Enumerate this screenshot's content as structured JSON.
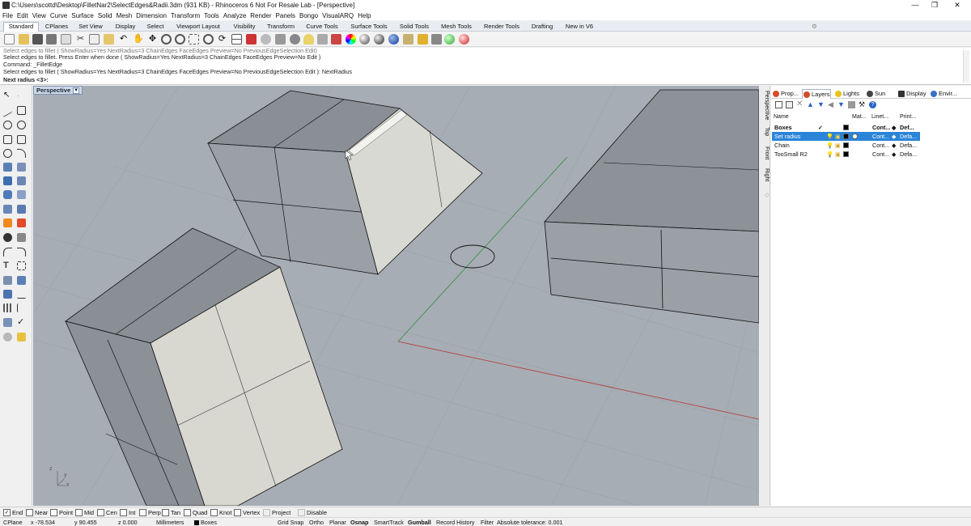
{
  "window": {
    "title": "C:\\Users\\scottd\\Desktop\\FilletNar2\\SelectEdges&Radii.3dm (931 KB) - Rhinoceros 6 Not For Resale Lab - [Perspective]",
    "min": "—",
    "max": "❐",
    "close": "✕"
  },
  "menu": [
    "File",
    "Edit",
    "View",
    "Curve",
    "Surface",
    "Solid",
    "Mesh",
    "Dimension",
    "Transform",
    "Tools",
    "Analyze",
    "Render",
    "Panels",
    "Bongo",
    "VisualARQ",
    "Help"
  ],
  "tabs": [
    "Standard",
    "CPlanes",
    "Set View",
    "Display",
    "Select",
    "Viewport Layout",
    "Visibility",
    "Transform",
    "Curve Tools",
    "Surface Tools",
    "Solid Tools",
    "Mesh Tools",
    "Render Tools",
    "Drafting",
    "New in V6"
  ],
  "command": {
    "history": [
      "Select edges to fillet ( ShowRadius=Yes  NextRadius=3  ChainEdges  FaceEdges  Preview=No  PreviousEdgeSelection  Edit)",
      "Select edges to fillet. Press Enter when done ( ShowRadius=Yes  NextRadius=3  ChainEdges  FaceEdges  Preview=No  Edit )",
      "Command: _FilletEdge",
      "Select edges to fillet ( ShowRadius=Yes  NextRadius=3  ChainEdges  FaceEdges  Preview=No  PreviousEdgeSelection  Edit ): NextRadius"
    ],
    "prompt": "Next radius <3>:"
  },
  "viewport": {
    "name": "Perspective",
    "axis_z": "z",
    "axis_y": "y",
    "axis_x": "x"
  },
  "viewport_tabs": [
    "Perspective",
    "Top",
    "Front",
    "Right"
  ],
  "panel": {
    "tabs": [
      "Prop...",
      "Layers",
      "Lights",
      "Sun",
      "Display",
      "Envir..."
    ],
    "tab_colors": [
      "#d64b2a",
      "#d04e26",
      "#e8c21a",
      "#444444",
      "#333333",
      "#3b6ec9"
    ],
    "columns": {
      "name": "Name",
      "material": "Mat...",
      "linetype": "Linet...",
      "print": "Print..."
    },
    "layers": [
      {
        "name": "Boxes",
        "current": "✓",
        "linetype": "Cont...",
        "print": "Def...",
        "bold": true,
        "selected": false
      },
      {
        "name": "Set radius",
        "current": "",
        "linetype": "Cont...",
        "print": "Defa...",
        "bold": false,
        "selected": true
      },
      {
        "name": "Chain",
        "current": "",
        "linetype": "Cont...",
        "print": "Defa...",
        "bold": false,
        "selected": false
      },
      {
        "name": "TooSmall R2",
        "current": "",
        "linetype": "Cont...",
        "print": "Defa...",
        "bold": false,
        "selected": false
      }
    ]
  },
  "osnap": [
    {
      "label": "End",
      "checked": true
    },
    {
      "label": "Near",
      "checked": false
    },
    {
      "label": "Point",
      "checked": false
    },
    {
      "label": "Mid",
      "checked": false
    },
    {
      "label": "Cen",
      "checked": false
    },
    {
      "label": "Int",
      "checked": false
    },
    {
      "label": "Perp",
      "checked": false
    },
    {
      "label": "Tan",
      "checked": false
    },
    {
      "label": "Quad",
      "checked": false
    },
    {
      "label": "Knot",
      "checked": false
    },
    {
      "label": "Vertex",
      "checked": false
    },
    {
      "label": "Project",
      "checked": false
    },
    {
      "label": "Disable",
      "checked": false
    }
  ],
  "status": {
    "cplane": "CPlane",
    "x": "x -78.534",
    "y": "y 90.455",
    "z": "z 0.000",
    "units": "Millimeters",
    "layer": "Boxes",
    "grid_snap": "Grid Snap",
    "ortho": "Ortho",
    "planar": "Planar",
    "osnap": "Osnap",
    "smarttrack": "SmartTrack",
    "gumball": "Gumball",
    "record_history": "Record History",
    "filter": "Filter",
    "tolerance": "Absolute tolerance: 0.001"
  },
  "colors": {
    "viewport_bg": "#a7adb4",
    "selection": "#2a84d8",
    "x_axis": "#b03a3a",
    "y_axis": "#2e8a3b"
  }
}
